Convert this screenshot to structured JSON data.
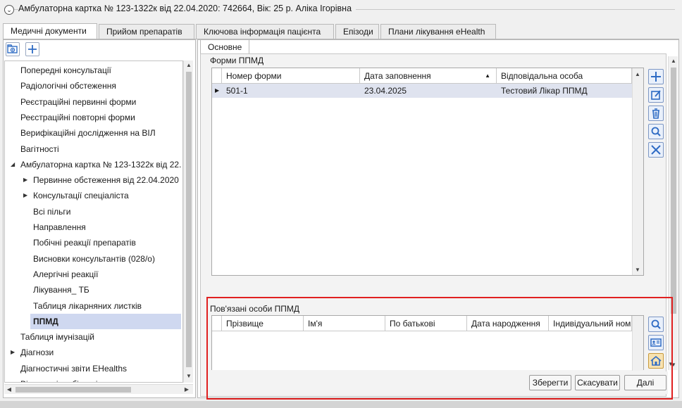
{
  "header": {
    "title": "Амбулаторна картка № 123-1322к від 22.04.2020: 742664, Вік: 25 р. Аліка Ігорівна"
  },
  "tabs": [
    {
      "label": "Медичні документи",
      "active": true
    },
    {
      "label": "Прийом препаратів",
      "active": false
    },
    {
      "label": "Ключова інформація пацієнта",
      "active": false
    },
    {
      "label": "Епізоди",
      "active": false
    },
    {
      "label": "Плани лікування eHealth",
      "active": false
    }
  ],
  "left_toolbar": {
    "add_folder_icon": "add-folder-icon",
    "add_icon": "plus-icon"
  },
  "tree": [
    {
      "label": "Попередні консультації",
      "level": 0,
      "expander": ""
    },
    {
      "label": "Радіологічні обстеження",
      "level": 0,
      "expander": ""
    },
    {
      "label": "Реєстраційні первинні форми",
      "level": 0,
      "expander": ""
    },
    {
      "label": "Реєстраційні повторні форми",
      "level": 0,
      "expander": ""
    },
    {
      "label": "Верифікаційні дослідження на ВІЛ",
      "level": 0,
      "expander": ""
    },
    {
      "label": "Вагітності",
      "level": 0,
      "expander": ""
    },
    {
      "label": "Амбулаторна картка № 123-1322к від 22.",
      "level": 0,
      "expander": "expanded"
    },
    {
      "label": "Первинне обстеження від 22.04.2020",
      "level": 1,
      "expander": "collapsed"
    },
    {
      "label": "Консультації спеціаліста",
      "level": 1,
      "expander": "collapsed"
    },
    {
      "label": "Всі пільги",
      "level": 1,
      "expander": ""
    },
    {
      "label": "Направлення",
      "level": 1,
      "expander": ""
    },
    {
      "label": "Побічні реакції препаратів",
      "level": 1,
      "expander": ""
    },
    {
      "label": "Висновки консультантів (028/о)",
      "level": 1,
      "expander": ""
    },
    {
      "label": "Алергічні реакції",
      "level": 1,
      "expander": ""
    },
    {
      "label": "Лікування_ ТБ",
      "level": 1,
      "expander": ""
    },
    {
      "label": "Таблиця лікарняних листків",
      "level": 1,
      "expander": ""
    },
    {
      "label": "ППМД",
      "level": 1,
      "expander": "",
      "selected": true
    },
    {
      "label": "Таблиця імунізацій",
      "level": 0,
      "expander": ""
    },
    {
      "label": "Діагнози",
      "level": 0,
      "expander": "collapsed"
    },
    {
      "label": "Діагностичні звіти EHealths",
      "level": 0,
      "expander": ""
    },
    {
      "label": "Візити співробітників",
      "level": 0,
      "expander": ""
    }
  ],
  "subtab": {
    "label": "Основне"
  },
  "forms_section": {
    "title": "Форми ППМД",
    "columns": [
      "Номер форми",
      "Дата заповнення",
      "Відповідальна особа"
    ],
    "sorted_column": "Дата заповнення",
    "rows": [
      {
        "number": "501-1",
        "date": "23.04.2025",
        "person": "Тестовий Лікар ППМД"
      }
    ]
  },
  "related_section": {
    "title": "Пов'язані особи ППМД",
    "columns": [
      "Прізвище",
      "Ім'я",
      "По батькові",
      "Дата народження",
      "Індивідуальний ном"
    ]
  },
  "buttons": {
    "save": "Зберегти",
    "cancel": "Скасувати",
    "next": "Далі"
  },
  "colors": {
    "accent": "#2e6bc4",
    "selection": "#cfd8f0",
    "highlight_border": "#e02020"
  }
}
